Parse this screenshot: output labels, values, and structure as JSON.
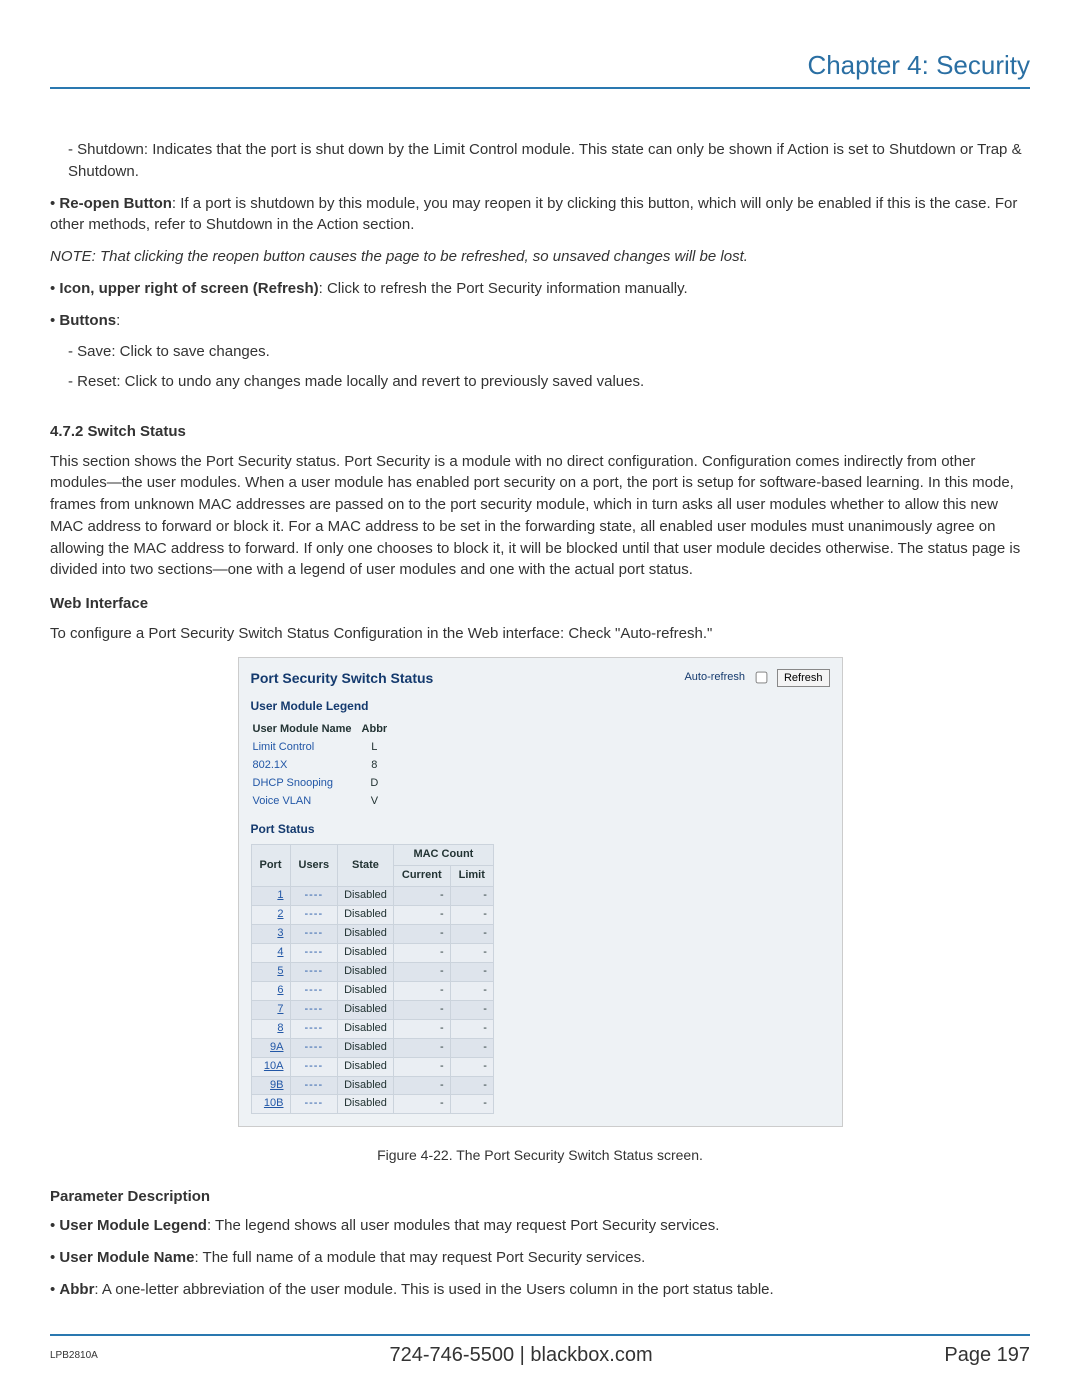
{
  "chapter_title": "Chapter 4: Security",
  "para_shutdown": "- Shutdown: Indicates that the port is shut down by the Limit Control module. This state can only be shown if Action is set to Shutdown or Trap & Shutdown.",
  "bullets": {
    "reopen_lead": "Re-open Button",
    "reopen_text": ": If a port is shutdown by this module, you may reopen it by clicking this button, which will only be enabled if this is the case. For other methods, refer to Shutdown in the Action section.",
    "note": "NOTE: That clicking the reopen button causes the page to be refreshed, so unsaved changes will be lost.",
    "refresh_lead": "Icon, upper right of screen (Refresh)",
    "refresh_text": ": Click to refresh the Port Security information manually.",
    "buttons_lead": "Buttons",
    "buttons_text": ":",
    "save": "- Save: Click to save changes.",
    "reset": "- Reset: Click to undo any changes made locally and revert to previously saved values."
  },
  "section_472": "4.7.2 Switch Status",
  "para_472": "This section shows the Port Security status. Port Security is a module with no direct configuration. Configuration comes indirectly from other modules—the user modules. When a user module has enabled port security on a port, the port is setup for software-based learning. In this mode, frames from unknown MAC addresses are passed on to the port security module, which in turn asks all user modules whether to allow this new MAC address to forward or block it. For a MAC address to be set in the forwarding state, all enabled user modules must unanimously agree on allowing the MAC address to forward. If only one chooses to block it, it will be blocked until that user module decides otherwise. The status page is divided into two sections—one with a legend of user modules and one with the actual port status.",
  "web_interface_head": "Web Interface",
  "web_interface_text": "To configure a Port Security Switch Status Configuration in the Web interface: Check \"Auto-refresh.\"",
  "shot": {
    "title": "Port Security Switch Status",
    "auto_refresh_label": "Auto-refresh",
    "refresh_button": "Refresh",
    "legend_title": "User Module Legend",
    "legend_headers": {
      "name": "User Module Name",
      "abbr": "Abbr"
    },
    "legend_rows": [
      {
        "name": "Limit Control",
        "abbr": "L"
      },
      {
        "name": "802.1X",
        "abbr": "8"
      },
      {
        "name": "DHCP Snooping",
        "abbr": "D"
      },
      {
        "name": "Voice VLAN",
        "abbr": "V"
      }
    ],
    "port_status_title": "Port Status",
    "port_headers": {
      "port": "Port",
      "users": "Users",
      "state": "State",
      "mac": "MAC Count",
      "current": "Current",
      "limit": "Limit"
    },
    "port_rows": [
      {
        "port": "1",
        "users": "----",
        "state": "Disabled",
        "current": "-",
        "limit": "-"
      },
      {
        "port": "2",
        "users": "----",
        "state": "Disabled",
        "current": "-",
        "limit": "-"
      },
      {
        "port": "3",
        "users": "----",
        "state": "Disabled",
        "current": "-",
        "limit": "-"
      },
      {
        "port": "4",
        "users": "----",
        "state": "Disabled",
        "current": "-",
        "limit": "-"
      },
      {
        "port": "5",
        "users": "----",
        "state": "Disabled",
        "current": "-",
        "limit": "-"
      },
      {
        "port": "6",
        "users": "----",
        "state": "Disabled",
        "current": "-",
        "limit": "-"
      },
      {
        "port": "7",
        "users": "----",
        "state": "Disabled",
        "current": "-",
        "limit": "-"
      },
      {
        "port": "8",
        "users": "----",
        "state": "Disabled",
        "current": "-",
        "limit": "-"
      },
      {
        "port": "9A",
        "users": "----",
        "state": "Disabled",
        "current": "-",
        "limit": "-"
      },
      {
        "port": "10A",
        "users": "----",
        "state": "Disabled",
        "current": "-",
        "limit": "-"
      },
      {
        "port": "9B",
        "users": "----",
        "state": "Disabled",
        "current": "-",
        "limit": "-"
      },
      {
        "port": "10B",
        "users": "----",
        "state": "Disabled",
        "current": "-",
        "limit": "-"
      }
    ]
  },
  "figure_caption": "Figure 4-22. The Port Security Switch Status screen.",
  "param_desc_head": "Parameter Description",
  "params": {
    "uml_lead": "User Module Legend",
    "uml_text": ": The legend shows all user modules that may request Port Security services.",
    "umn_lead": "User Module Name",
    "umn_text": ": The full name of a module that may request Port Security services.",
    "abbr_lead": "Abbr",
    "abbr_text": ": A one-letter abbreviation of the user module. This is used in the Users column in the port status table."
  },
  "footer": {
    "left": "LPB2810A",
    "mid": "724-746-5500   |   blackbox.com",
    "right": "Page 197"
  }
}
